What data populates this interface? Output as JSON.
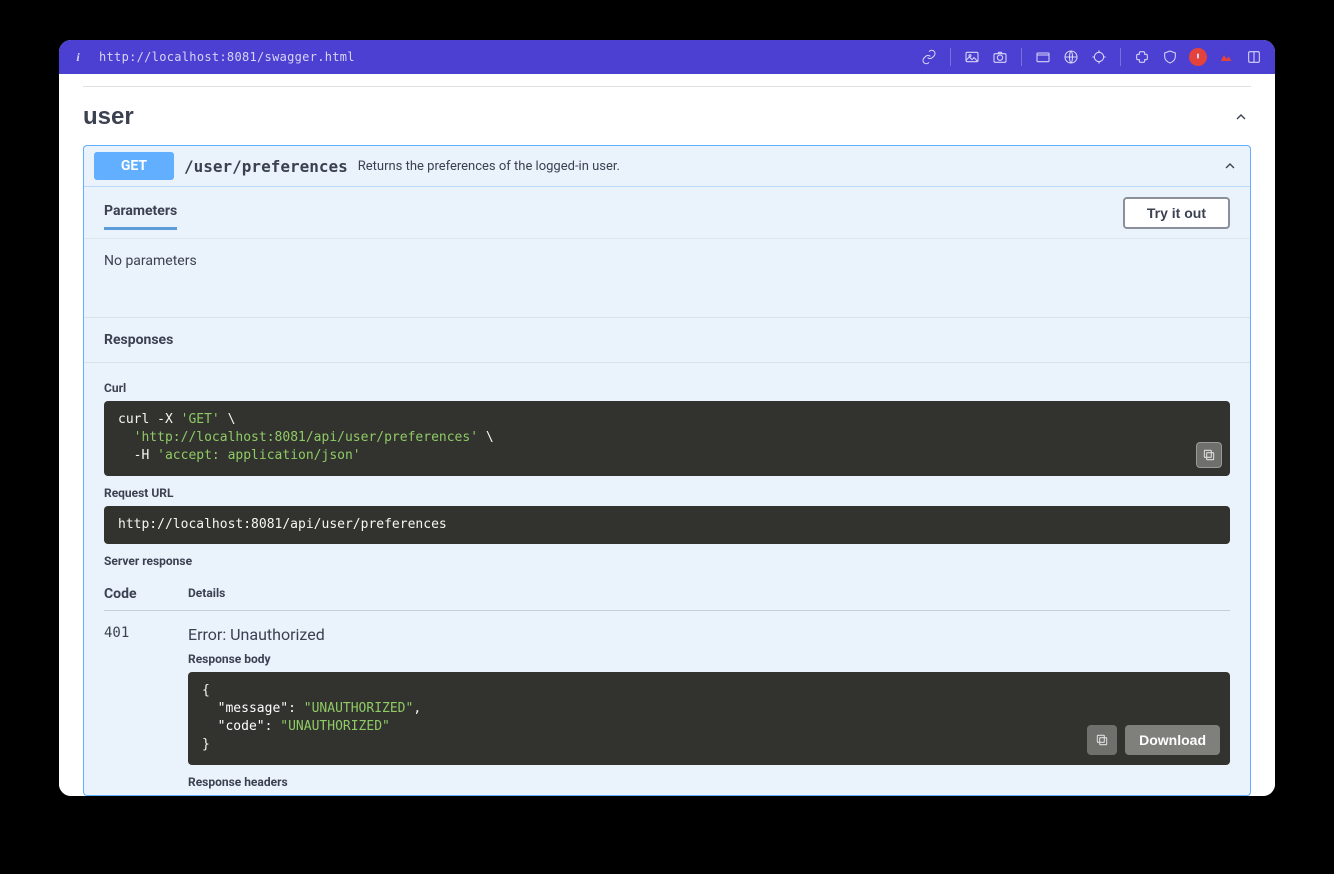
{
  "browser": {
    "url": "http://localhost:8081/swagger.html"
  },
  "section": {
    "title": "user"
  },
  "operation": {
    "method": "GET",
    "path": "/user/preferences",
    "description": "Returns the preferences of the logged-in user."
  },
  "params": {
    "tab_label": "Parameters",
    "tryout_label": "Try it out",
    "empty_text": "No parameters"
  },
  "responses": {
    "heading": "Responses",
    "curl_label": "Curl",
    "curl_lines": {
      "l1a": "curl -X ",
      "l1b": "'GET'",
      "l1c": " \\",
      "l2a": "  ",
      "l2b": "'http://localhost:8081/api/user/preferences'",
      "l2c": " \\",
      "l3a": "  -H ",
      "l3b": "'accept: application/json'"
    },
    "request_url_label": "Request URL",
    "request_url": "http://localhost:8081/api/user/preferences",
    "server_response_label": "Server response",
    "code_header": "Code",
    "details_header": "Details",
    "status_code": "401",
    "error_text": "Error: Unauthorized",
    "body_label": "Response body",
    "body_json": {
      "open": "{",
      "k1": "\"message\"",
      "v1": "\"UNAUTHORIZED\"",
      "comma": ",",
      "k2": "\"code\"",
      "v2": "\"UNAUTHORIZED\"",
      "close": "}"
    },
    "download_label": "Download",
    "headers_label": "Response headers"
  }
}
